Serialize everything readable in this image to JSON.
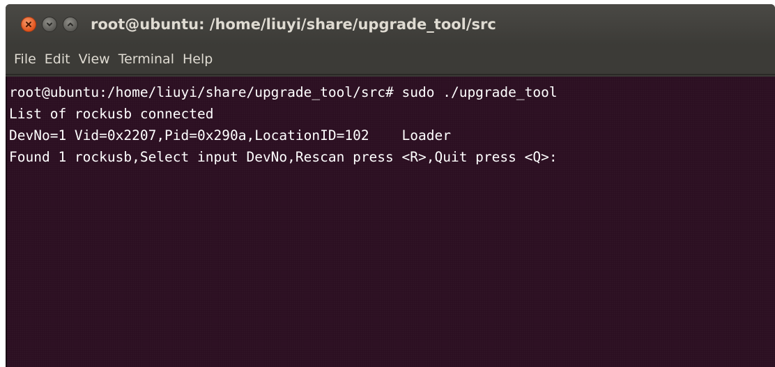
{
  "window": {
    "title": "root@ubuntu: /home/liuyi/share/upgrade_tool/src"
  },
  "menu": {
    "items": [
      "File",
      "Edit",
      "View",
      "Terminal",
      "Help"
    ]
  },
  "terminal": {
    "lines": [
      "root@ubuntu:/home/liuyi/share/upgrade_tool/src# sudo ./upgrade_tool",
      "List of rockusb connected",
      "DevNo=1 Vid=0x2207,Pid=0x290a,LocationID=102    Loader",
      "Found 1 rockusb,Select input DevNo,Rescan press <R>,Quit press <Q>:"
    ]
  },
  "colors": {
    "terminal_background": "#2c0f22",
    "titlebar": "#3c3b37",
    "close_button": "#e0531c"
  },
  "icons": [
    "close-icon",
    "minimize-icon",
    "maximize-icon"
  ]
}
